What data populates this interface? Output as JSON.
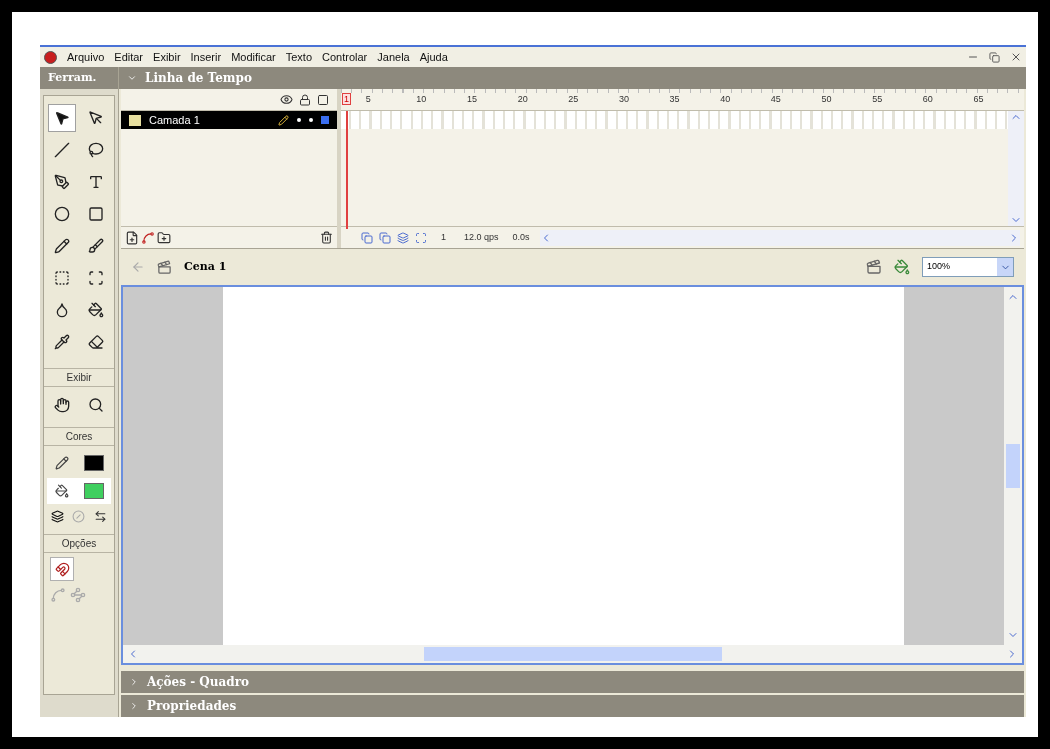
{
  "menu": {
    "items": [
      "Arquivo",
      "Editar",
      "Exibir",
      "Inserir",
      "Modificar",
      "Texto",
      "Controlar",
      "Janela",
      "Ajuda"
    ]
  },
  "toolbar": {
    "title": "Ferram.",
    "tools": [
      {
        "kind": "arrow",
        "selected": true
      },
      {
        "kind": "subselect",
        "selected": false
      },
      {
        "kind": "line",
        "selected": false
      },
      {
        "kind": "lasso",
        "selected": false
      },
      {
        "kind": "pen",
        "selected": false
      },
      {
        "kind": "text",
        "selected": false
      },
      {
        "kind": "oval",
        "selected": false
      },
      {
        "kind": "rectangle",
        "selected": false
      },
      {
        "kind": "pencil",
        "selected": false
      },
      {
        "kind": "brush",
        "selected": false
      },
      {
        "kind": "transform",
        "selected": false
      },
      {
        "kind": "fill-transform",
        "selected": false
      },
      {
        "kind": "ink-bottle",
        "selected": false
      },
      {
        "kind": "bucket",
        "selected": false
      },
      {
        "kind": "eyedropper",
        "selected": false
      },
      {
        "kind": "eraser",
        "selected": false
      }
    ],
    "view_title": "Exibir",
    "view_tools": [
      {
        "kind": "hand",
        "selected": false
      },
      {
        "kind": "zoom",
        "selected": false
      }
    ],
    "colors_title": "Cores",
    "swatches": [
      {
        "kind": "stroke",
        "color": "#000000",
        "selected": false
      },
      {
        "kind": "fill",
        "color": "#3fcf5f",
        "selected": true
      }
    ],
    "options_title": "Opções",
    "snap": {
      "on": true
    }
  },
  "timeline": {
    "title": "Linha de Tempo",
    "expanded": true,
    "layers": [
      {
        "name": "Camada 1",
        "selected": true
      }
    ],
    "ruler": [
      "1",
      "5",
      "10",
      "15",
      "20",
      "25",
      "30",
      "35",
      "40",
      "45",
      "50",
      "55",
      "60",
      "65"
    ],
    "current_frame": "1",
    "frame_rate": "12.0 qps",
    "elapsed": "0.0s"
  },
  "scene": {
    "name": "Cena 1",
    "zoom": "100%"
  },
  "panels": [
    {
      "title": "Ações - Quadro",
      "expanded": false
    },
    {
      "title": "Propriedades",
      "expanded": false
    }
  ]
}
